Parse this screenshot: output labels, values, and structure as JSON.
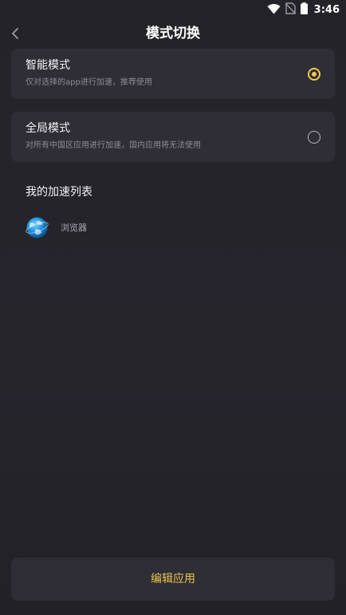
{
  "status_bar": {
    "time": "3:46",
    "icons": [
      "wifi-icon",
      "no-sim-icon",
      "battery-icon"
    ]
  },
  "header": {
    "back_icon": "chevron-left-icon",
    "title": "模式切换"
  },
  "modes": [
    {
      "title": "智能模式",
      "description": "仅对选择的app进行加速，推荐使用",
      "selected": true
    },
    {
      "title": "全局模式",
      "description": "对所有中国区应用进行加速，国内应用将无法使用",
      "selected": false
    }
  ],
  "accelerate_list": {
    "title": "我的加速列表",
    "items": [
      {
        "name": "浏览器",
        "icon": "globe-icon"
      }
    ]
  },
  "footer": {
    "edit_label": "编辑应用"
  },
  "colors": {
    "accent": "#f1c84b",
    "background": "#25242b",
    "card": "#2f2e36"
  }
}
